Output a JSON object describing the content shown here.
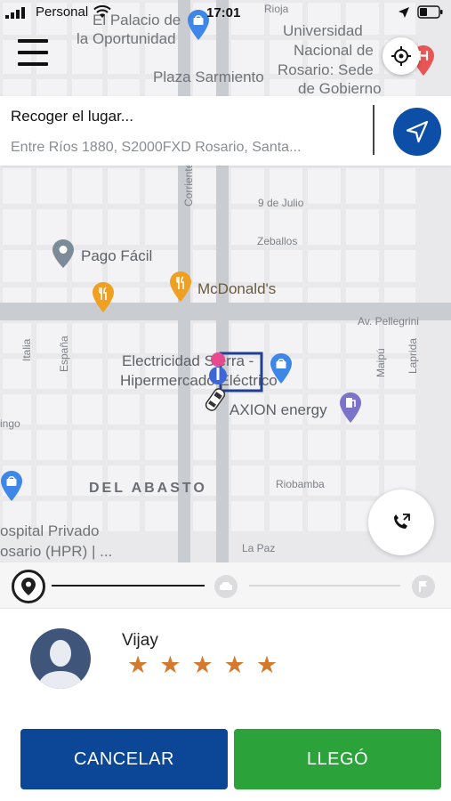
{
  "status_bar": {
    "carrier": "Personal",
    "time": "17:01"
  },
  "map": {
    "labels": {
      "palacio_line1": "El Palacio de",
      "palacio_line2": "la Oportunidad",
      "universidad_line1": "Universidad",
      "universidad_line2": "Nacional de",
      "universidad_line3": "Rosario: Sede",
      "universidad_line4": "de Gobierno",
      "rioja": "Rioja",
      "plaza": "Plaza Sarmiento",
      "nueve_julio": "9 de Julio",
      "zeballos": "Zeballos",
      "pellegrini": "Av. Pellegrini",
      "corrientes": "Corrientes",
      "espana": "España",
      "italia": "Italia",
      "maipu": "Maipú",
      "laprida": "Laprida",
      "pago_facil": "Pago Fácil",
      "mcdonalds": "McDonald's",
      "electricidad_line1": "Electricidad Sierra -",
      "electricidad_line2": "Hipermercado Eléctrico",
      "axion": "AXION energy",
      "del_abasto": "DEL ABASTO",
      "riobamba": "Riobamba",
      "la_paz": "La Paz",
      "hospital_line1": "ospital Privado",
      "hospital_line2": "osario (HPR) | ...",
      "ingo": "ingo"
    }
  },
  "pickup": {
    "title": "Recoger el lugar...",
    "address": "Entre Ríos 1880, S2000FXD Rosario, Santa..."
  },
  "driver": {
    "name": "Vijay",
    "rating": 5,
    "star_color": "#d47a2e"
  },
  "actions": {
    "cancel_label": "CANCELAR",
    "arrived_label": "LLEGÓ"
  },
  "colors": {
    "primary_blue": "#0b4796",
    "success_green": "#2ba33a",
    "nav_blue": "#0d4ea6"
  },
  "icons": {
    "menu": "hamburger-icon",
    "locate": "crosshair-icon",
    "navigate": "navigation-arrow-icon",
    "call": "phone-call-icon",
    "pickup_step": "location-pin-icon",
    "car_step": "car-icon",
    "flag_step": "flag-icon"
  }
}
